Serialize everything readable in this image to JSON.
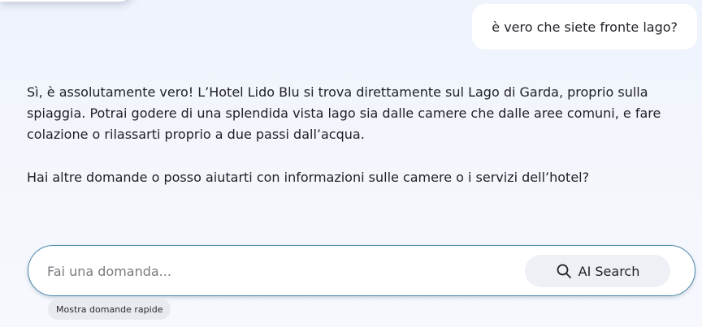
{
  "chat": {
    "user_message": "è vero che siete fronte lago?",
    "assistant_paragraphs": [
      "Sì, è assolutamente vero! L’Hotel Lido Blu si trova direttamente sul Lago di Garda, proprio sulla spiaggia. Potrai godere di una splendida vista lago sia dalle camere che dalle aree comuni, e fare colazione o rilassarti proprio a due passi dall’acqua.",
      "Hai altre domande o posso aiutarti con informazioni sulle camere o i servizi dell’hotel?"
    ]
  },
  "composer": {
    "placeholder": "Fai una domanda...",
    "value": "",
    "search_button_label": "AI Search",
    "search_icon": "search-icon",
    "quick_questions_label": "Mostra domande rapide"
  },
  "colors": {
    "input_border": "#4a88a8",
    "background": "#eef3fc",
    "button_bg": "#eef0f6"
  }
}
